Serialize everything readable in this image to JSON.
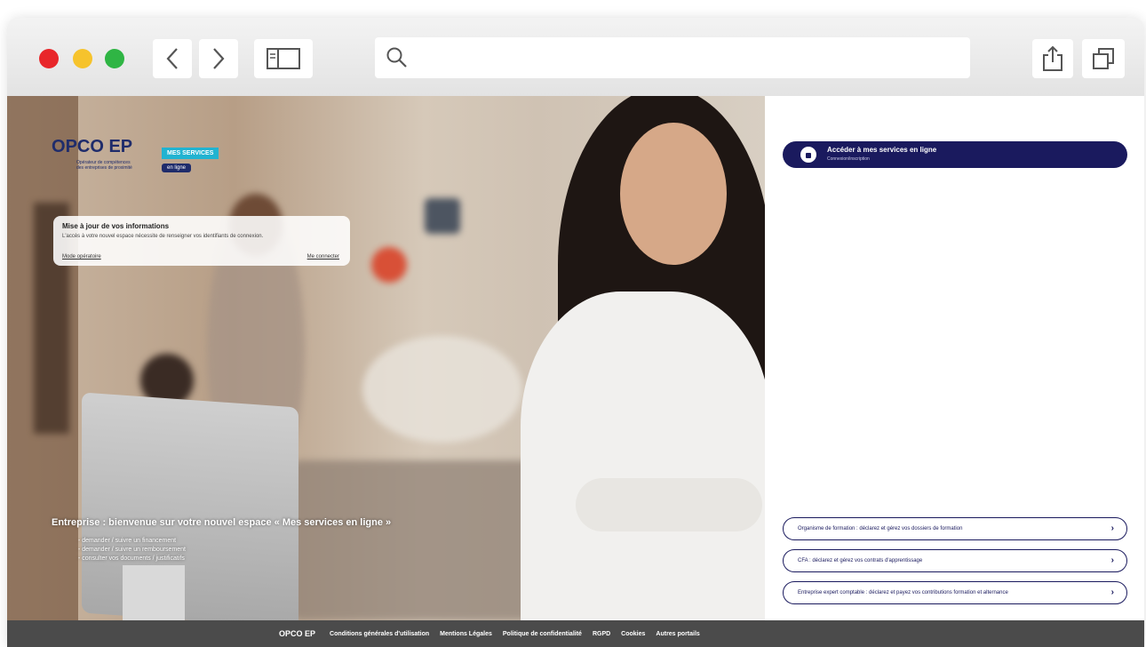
{
  "hero": {
    "logo": {
      "brand": "PCO",
      "ep": "EP",
      "o_letter": "O",
      "subtitle": "Opérateur de compétences des entreprises de proximité"
    },
    "badge": {
      "title": "MES SERVICES",
      "subtitle": "en ligne"
    },
    "notice": {
      "title": "Mise à jour de vos informations",
      "description": "L'accès à votre nouvel espace nécessite de renseigner vos identifiants de connexion.",
      "link_left": "Mode opératoire",
      "link_right": "Me connecter"
    },
    "welcome": "Entreprise : bienvenue sur votre nouvel espace « Mes services en ligne »",
    "bullets": [
      "- demander / suivre un financement",
      "- demander / suivre un remboursement",
      "- consulter vos documents / justificatifs"
    ]
  },
  "right_panel": {
    "access_button": {
      "title": "Accéder à mes services en ligne",
      "subtitle": "Connexion/inscription"
    },
    "links": [
      "Organisme de formation : déclarez et gérez vos dossiers de formation",
      "CFA : déclarez et gérez vos contrats d'apprentissage",
      "Entreprise expert comptable : déclarez et payez vos contributions formation et alternance"
    ]
  },
  "footer": {
    "logo": "OPCO EP",
    "links": [
      "Conditions générales d'utilisation",
      "Mentions Légales",
      "Politique de confidentialité",
      "RGPD",
      "Cookies",
      "Autres portails"
    ]
  },
  "colors": {
    "navy": "#1a1a5e",
    "cyan": "#21b3d1",
    "footer": "#4b4b4b"
  },
  "icons": [
    "back-icon",
    "forward-icon",
    "sidebar-icon",
    "search-icon",
    "share-icon",
    "tabs-icon",
    "user-lock-icon",
    "chevron-right-icon"
  ]
}
